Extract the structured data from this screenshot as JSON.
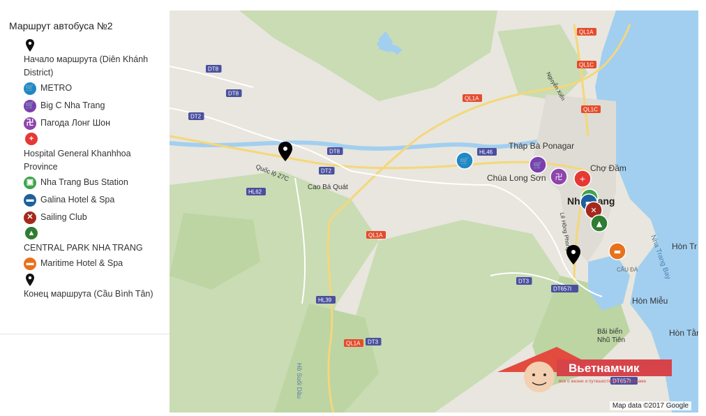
{
  "sidebar": {
    "title": "Маршрут автобуса №2",
    "items": [
      {
        "label": "Начало маршрута (Diên Khánh District)",
        "icon": "black-pin-icon",
        "color": "#111111",
        "layout": "block"
      },
      {
        "label": "METRO",
        "icon": "shopping-cart-icon",
        "color": "#1e88c9",
        "layout": "inline"
      },
      {
        "label": "Big C Nha Trang",
        "icon": "shopping-cart-icon",
        "color": "#7b3fb0",
        "layout": "inline"
      },
      {
        "label": "Пагода Лонг Шон",
        "icon": "pagoda-icon",
        "color": "#8e44ad",
        "layout": "inline"
      },
      {
        "label": "Hospital General Khanhhoa Province",
        "icon": "medical-cross-icon",
        "color": "#e53935",
        "layout": "block"
      },
      {
        "label": "Nha Trang Bus Station",
        "icon": "bus-icon",
        "color": "#3fa34d",
        "layout": "inline"
      },
      {
        "label": "Galina Hotel & Spa",
        "icon": "hotel-bed-icon",
        "color": "#1e5f9e",
        "layout": "inline"
      },
      {
        "label": "Sailing Club",
        "icon": "restaurant-icon",
        "color": "#a5281d",
        "layout": "inline"
      },
      {
        "label": "CENTRAL PARK NHA TRANG",
        "icon": "tree-icon",
        "color": "#2e7d32",
        "layout": "block"
      },
      {
        "label": "Maritime Hotel & Spa",
        "icon": "hotel-bed-icon",
        "color": "#e8711c",
        "layout": "inline"
      },
      {
        "label": "Конец маршрута (Cầu Bình Tân)",
        "icon": "black-pin-icon",
        "color": "#111111",
        "layout": "block"
      }
    ]
  },
  "map": {
    "places": {
      "thap_ba": "Tháp Bà Ponagar",
      "cho_dam": "Chợ Đầm",
      "chua_long_son": "Chùa Long Sơn",
      "nha_trang": "Nha Trang",
      "hon_tre": "Hòn Tr",
      "nha_trang_bay": "Nha Trang Bay",
      "cau_da": "CẦU ĐÁ",
      "hon_mieu": "Hòn Miễu",
      "bai_bien": "Bãi biển",
      "nhu_tien": "Nhũ Tiên",
      "hon_tan": "Hòn Tằn",
      "cao_ba_quat": "Cao Bá Quát",
      "quoc_lo": "Quốc lộ 27C",
      "le_hong_phong": "Lê Hồng Phong",
      "nguyen_xien": "Nguyễn Xiển",
      "ho_suoi_dau": "Hồ Suối Dầu"
    },
    "road_shields": [
      "QL1A",
      "QL1C",
      "QL1C",
      "DT8",
      "DT8",
      "DT2",
      "DT2",
      "DT8",
      "HL46",
      "HL62",
      "QL1A",
      "DT3",
      "DT657I",
      "HL39",
      "QL1A",
      "DT3",
      "QL1A",
      "DT657I"
    ],
    "attribution": "Map data ©2017 Google",
    "watermark_title": "Вьетнамчик",
    "watermark_subtitle": "все о жизни и путешествиях во Вьетнаме"
  }
}
